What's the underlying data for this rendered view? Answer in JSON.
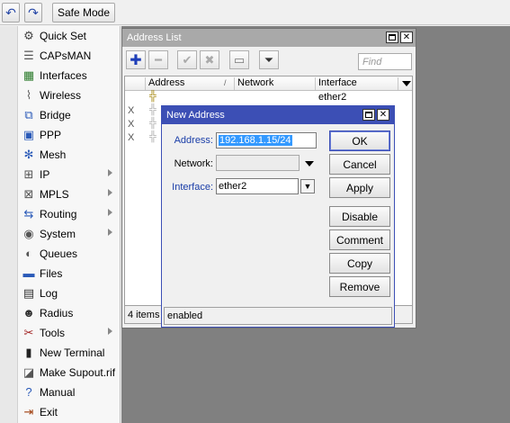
{
  "toolbar": {
    "undo_icon": "undo-icon",
    "redo_icon": "redo-icon",
    "safe_mode_label": "Safe Mode"
  },
  "sidebar": {
    "items": [
      {
        "label": "Quick Set",
        "icon": "quickset-icon",
        "submenu": false
      },
      {
        "label": "CAPsMAN",
        "icon": "capsman-icon",
        "submenu": false
      },
      {
        "label": "Interfaces",
        "icon": "interfaces-icon",
        "submenu": false
      },
      {
        "label": "Wireless",
        "icon": "wireless-icon",
        "submenu": false
      },
      {
        "label": "Bridge",
        "icon": "bridge-icon",
        "submenu": false
      },
      {
        "label": "PPP",
        "icon": "ppp-icon",
        "submenu": false
      },
      {
        "label": "Mesh",
        "icon": "mesh-icon",
        "submenu": false
      },
      {
        "label": "IP",
        "icon": "ip-icon",
        "submenu": true
      },
      {
        "label": "MPLS",
        "icon": "mpls-icon",
        "submenu": true
      },
      {
        "label": "Routing",
        "icon": "routing-icon",
        "submenu": true
      },
      {
        "label": "System",
        "icon": "system-icon",
        "submenu": true
      },
      {
        "label": "Queues",
        "icon": "queues-icon",
        "submenu": false
      },
      {
        "label": "Files",
        "icon": "files-icon",
        "submenu": false
      },
      {
        "label": "Log",
        "icon": "log-icon",
        "submenu": false
      },
      {
        "label": "Radius",
        "icon": "radius-icon",
        "submenu": false
      },
      {
        "label": "Tools",
        "icon": "tools-icon",
        "submenu": true
      },
      {
        "label": "New Terminal",
        "icon": "terminal-icon",
        "submenu": false
      },
      {
        "label": "Make Supout.rif",
        "icon": "supout-icon",
        "submenu": false
      },
      {
        "label": "Manual",
        "icon": "manual-icon",
        "submenu": false
      },
      {
        "label": "Exit",
        "icon": "exit-icon",
        "submenu": false
      }
    ]
  },
  "address_list": {
    "title": "Address List",
    "find_placeholder": "Find",
    "columns": [
      "Address",
      "Network",
      "Interface"
    ],
    "rows": [
      {
        "flag": "",
        "address": "",
        "network": "",
        "interface": "ether2"
      },
      {
        "flag": "X",
        "address": "",
        "network": "",
        "interface": ""
      },
      {
        "flag": "X",
        "address": "",
        "network": "",
        "interface": ""
      },
      {
        "flag": "X",
        "address": "",
        "network": "",
        "interface": ""
      }
    ],
    "status": "4 items"
  },
  "new_address": {
    "title": "New Address",
    "address_label": "Address:",
    "address_value": "192.168.1.15/24",
    "network_label": "Network:",
    "network_value": "",
    "interface_label": "Interface:",
    "interface_value": "ether2",
    "buttons": {
      "ok": "OK",
      "cancel": "Cancel",
      "apply": "Apply",
      "disable": "Disable",
      "comment": "Comment",
      "copy": "Copy",
      "remove": "Remove"
    },
    "status": "enabled"
  },
  "colors": {
    "accent": "#3c4fb5",
    "label_blue": "#1a3ea8",
    "selection": "#3399ff",
    "workspace": "#808080"
  }
}
